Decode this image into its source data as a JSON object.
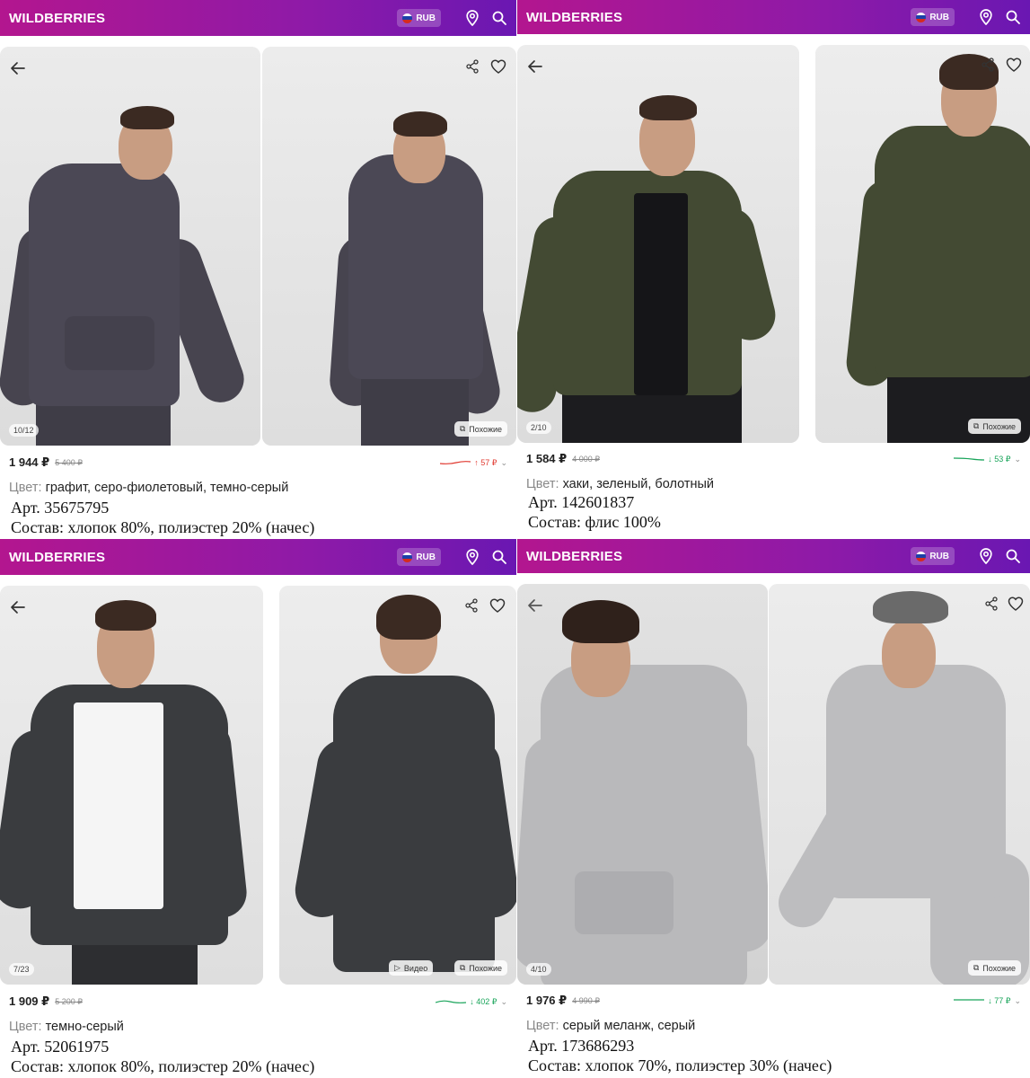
{
  "header": {
    "logo": "WILDBERRIES",
    "currency": "RUB",
    "brand_gradient": [
      "#b3168f",
      "#6a17b2"
    ],
    "icons": [
      "location-pin-icon",
      "search-icon"
    ]
  },
  "products": [
    {
      "counter": "10/12",
      "similar_label": "Похожие",
      "video_label": "",
      "price": "1 944 ₽",
      "old_price": "5 400 ₽",
      "trend": "↑ 57 ₽",
      "trend_dir": "up",
      "color_label": "Цвет:",
      "color_value": "графит, серо-фиолетовый, темно-серый",
      "article": "Арт. 35675795",
      "composition": "Состав: хлопок 80%, полиэстер 20% (начес)",
      "garment_color": "#4b4855"
    },
    {
      "counter": "2/10",
      "similar_label": "Похожие",
      "video_label": "",
      "price": "1 584 ₽",
      "old_price": "4 000 ₽",
      "trend": "↓ 53 ₽",
      "trend_dir": "down",
      "color_label": "Цвет:",
      "color_value": "хаки, зеленый, болотный",
      "article": "Арт. 142601837",
      "composition": "Состав: флис 100%",
      "garment_color": "#434a33"
    },
    {
      "counter": "7/23",
      "similar_label": "Похожие",
      "video_label": "Видео",
      "price": "1 909 ₽",
      "old_price": "5 200 ₽",
      "trend": "↓ 402 ₽",
      "trend_dir": "down",
      "color_label": "Цвет:",
      "color_value": "темно-серый",
      "article": "Арт. 52061975",
      "composition": "Состав: хлопок 80%, полиэстер 20% (начес)",
      "garment_color": "#3a3c3f"
    },
    {
      "counter": "4/10",
      "similar_label": "Похожие",
      "video_label": "",
      "price": "1 976 ₽",
      "old_price": "4 990 ₽",
      "trend": "↓ 77 ₽",
      "trend_dir": "down",
      "color_label": "Цвет:",
      "color_value": "серый меланж, серый",
      "article": "Арт. 173686293",
      "composition": "Состав: хлопок 70%, полиэстер 30% (начес)",
      "garment_color": "#b9b9bb"
    }
  ]
}
